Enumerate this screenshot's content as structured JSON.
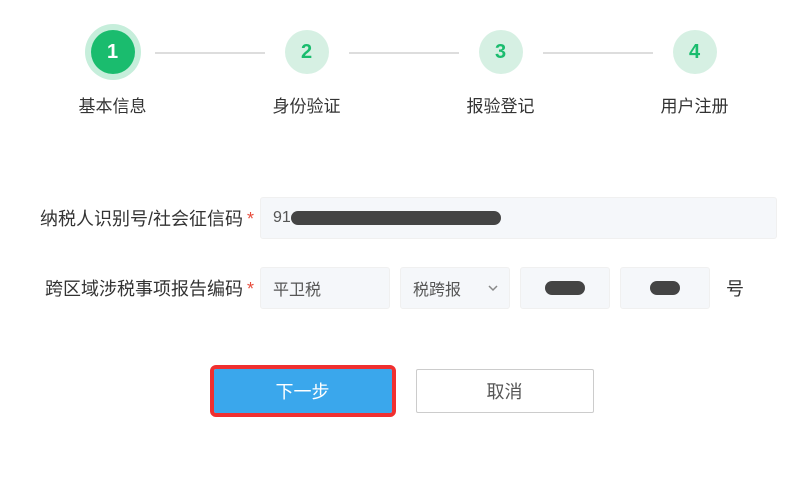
{
  "stepper": {
    "steps": [
      {
        "num": "1",
        "label": "基本信息",
        "active": true
      },
      {
        "num": "2",
        "label": "身份验证",
        "active": false
      },
      {
        "num": "3",
        "label": "报验登记",
        "active": false
      },
      {
        "num": "4",
        "label": "用户注册",
        "active": false
      }
    ]
  },
  "form": {
    "taxpayer_id": {
      "label": "纳税人识别号/社会征信码",
      "value_prefix": "91"
    },
    "cross_region": {
      "label": "跨区域涉税事项报告编码",
      "seg1": "平卫税",
      "seg2_selected": "税跨报",
      "suffix": "号"
    }
  },
  "actions": {
    "next": "下一步",
    "cancel": "取消"
  }
}
